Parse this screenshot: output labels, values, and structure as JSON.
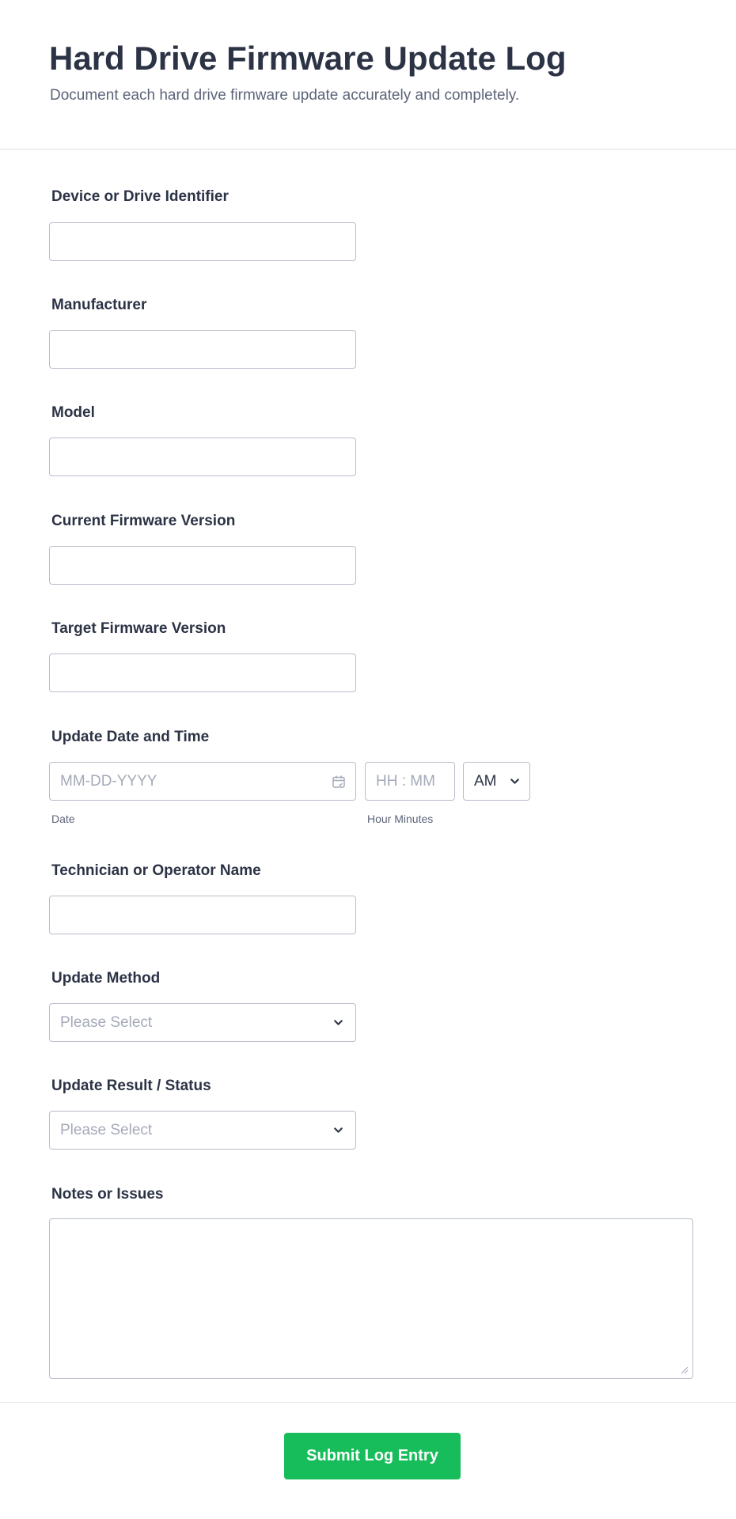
{
  "form": {
    "title": "Hard Drive Firmware Update Log",
    "subtitle": "Document each hard drive firmware update accurately and completely."
  },
  "fields": {
    "device_identifier": {
      "label": "Device or Drive Identifier",
      "value": ""
    },
    "manufacturer": {
      "label": "Manufacturer",
      "value": ""
    },
    "model": {
      "label": "Model",
      "value": ""
    },
    "current_firmware": {
      "label": "Current Firmware Version",
      "value": ""
    },
    "target_firmware": {
      "label": "Target Firmware Version",
      "value": ""
    },
    "update_datetime": {
      "label": "Update Date and Time",
      "date_placeholder": "MM-DD-YYYY",
      "date_sublabel": "Date",
      "time_placeholder": "HH : MM",
      "time_sublabel": "Hour Minutes",
      "ampm_value": "AM"
    },
    "technician": {
      "label": "Technician or Operator Name",
      "value": ""
    },
    "update_method": {
      "label": "Update Method",
      "placeholder": "Please Select"
    },
    "update_result": {
      "label": "Update Result / Status",
      "placeholder": "Please Select"
    },
    "notes": {
      "label": "Notes or Issues",
      "value": ""
    }
  },
  "actions": {
    "submit_label": "Submit Log Entry"
  },
  "colors": {
    "submit_button": "#18bd5b",
    "text": "#2c3345",
    "muted": "#5c6478",
    "placeholder": "#a4aab8",
    "border": "#b8bdc9"
  },
  "icons": [
    "calendar-icon",
    "chevron-down-icon",
    "resize-grip-icon"
  ]
}
